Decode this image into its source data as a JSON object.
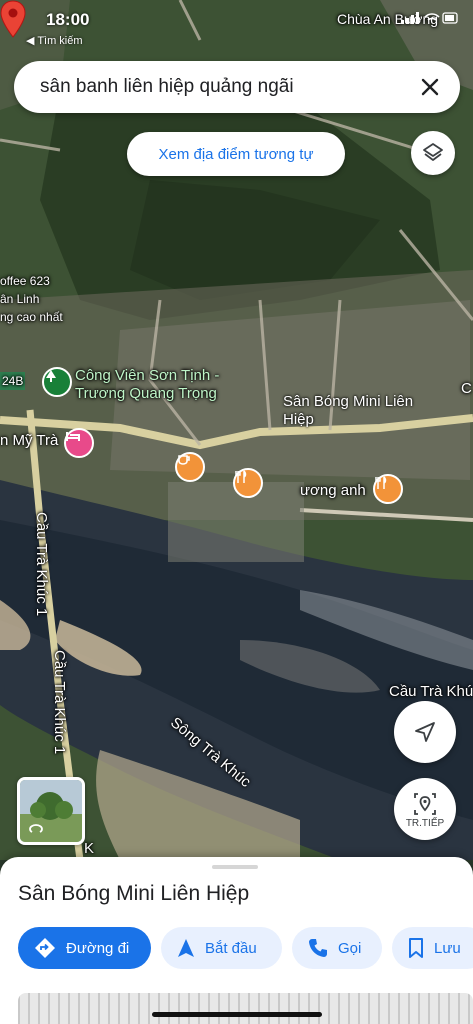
{
  "status": {
    "time": "18:00",
    "back_label": "◀ Tìm kiếm",
    "carrier_label": "Chùa An Bường"
  },
  "search": {
    "query": "sân banh liên hiệp quảng ngãi",
    "close_icon": "close-icon"
  },
  "similar_button": {
    "label": "Xem địa điểm tương tự"
  },
  "map_labels": {
    "coffee": "offee 623",
    "an_linh": "ân Linh",
    "cao_nhat": "ng cao nhất",
    "road_code": "24B",
    "park": "Công Viên Sơn Tịnh -",
    "park2": "Trương Quang Trọng",
    "hotel": "n Mỹ Trà",
    "pin_line1": "Sân Bóng Mini Liên",
    "pin_line2": "Hiệp",
    "food": "ương anh",
    "bridge_road": "Cầu Trà Khúc 1",
    "bridge_road2": "Cầu Trà Khúc 1",
    "river": "Sông Trà Khúc",
    "bridge_right": "Cầu Trà Khú",
    "edge_c": "C",
    "edge_k": "K"
  },
  "controls": {
    "street_view_label": "TR.TIẾP"
  },
  "place": {
    "title": "Sân Bóng Mini Liên Hiệp",
    "actions": [
      {
        "label": "Đường đi",
        "icon": "directions-icon"
      },
      {
        "label": "Bắt đầu",
        "icon": "navigation-arrow-icon"
      },
      {
        "label": "Gọi",
        "icon": "phone-icon"
      },
      {
        "label": "Lưu",
        "icon": "bookmark-icon"
      }
    ]
  },
  "colors": {
    "accent": "#1a73e8",
    "pin": "#ea4335",
    "hotel": "#e84a8a",
    "food": "#f29339"
  }
}
